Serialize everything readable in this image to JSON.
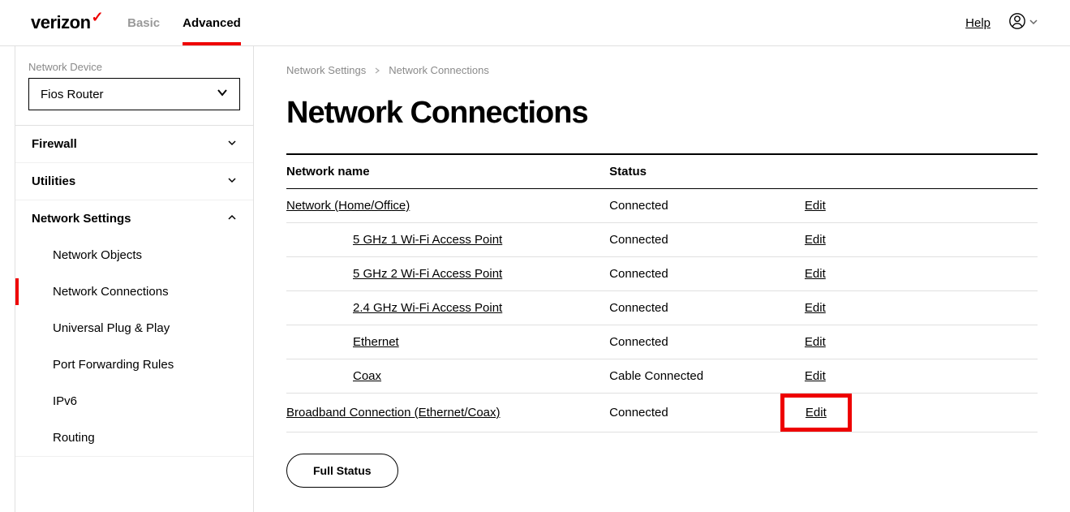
{
  "header": {
    "brand": "verizon",
    "tabs": {
      "basic": "Basic",
      "advanced": "Advanced"
    },
    "help": "Help"
  },
  "sidebar": {
    "device_label": "Network Device",
    "device_value": "Fios Router",
    "groups": {
      "firewall": "Firewall",
      "utilities": "Utilities",
      "network_settings": "Network Settings"
    },
    "subs": {
      "network_objects": "Network Objects",
      "network_connections": "Network Connections",
      "upnp": "Universal Plug & Play",
      "port_forwarding": "Port Forwarding Rules",
      "ipv6": "IPv6",
      "routing": "Routing"
    }
  },
  "breadcrumb": {
    "a": "Network Settings",
    "b": "Network Connections"
  },
  "page": {
    "title": "Network Connections"
  },
  "table": {
    "headers": {
      "name": "Network name",
      "status": "Status"
    },
    "edit_label": "Edit",
    "rows": [
      {
        "name": "Network (Home/Office)",
        "status": "Connected",
        "indent": false
      },
      {
        "name": "5 GHz 1 Wi-Fi Access Point",
        "status": "Connected",
        "indent": true
      },
      {
        "name": "5 GHz 2 Wi-Fi Access Point",
        "status": "Connected",
        "indent": true
      },
      {
        "name": "2.4 GHz Wi-Fi Access Point",
        "status": "Connected",
        "indent": true
      },
      {
        "name": "Ethernet",
        "status": "Connected",
        "indent": true
      },
      {
        "name": "Coax",
        "status": "Cable Connected",
        "indent": true
      },
      {
        "name": "Broadband Connection (Ethernet/Coax)",
        "status": "Connected",
        "indent": false
      }
    ]
  },
  "buttons": {
    "full_status": "Full Status"
  }
}
